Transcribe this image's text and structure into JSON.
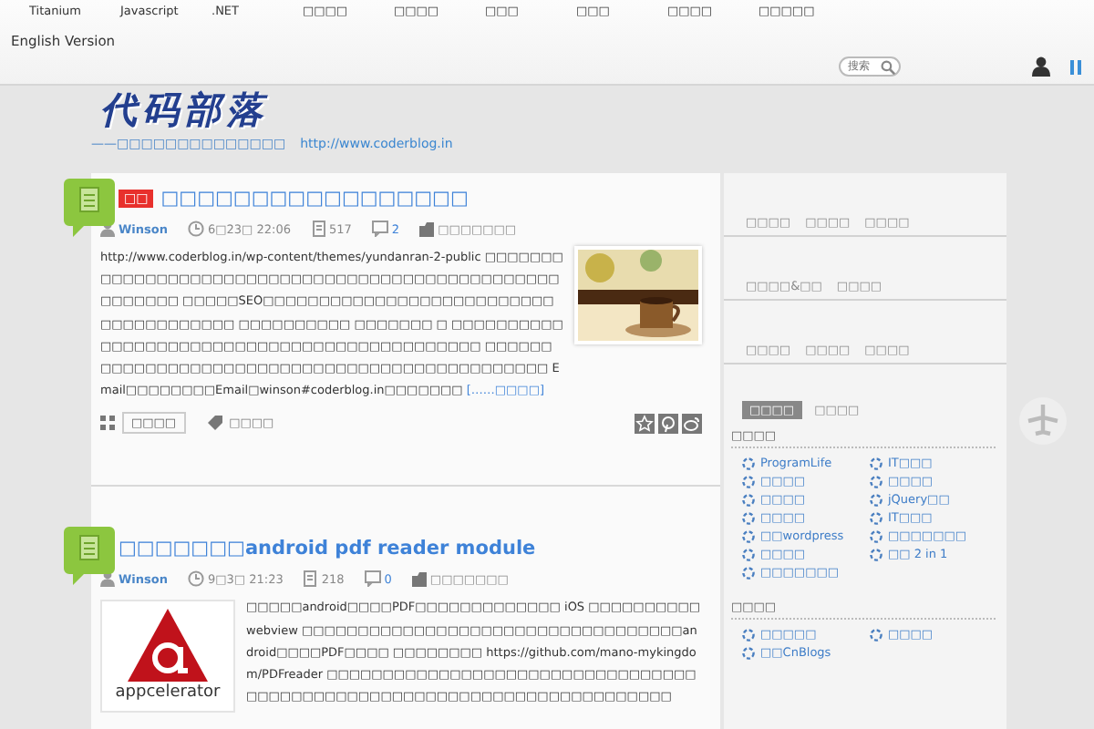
{
  "nav": {
    "items": [
      "Titanium",
      "Javascript",
      ".NET",
      "□□□□",
      "□□□□",
      "□□□",
      "□□□",
      "□□□□",
      "□□□□□"
    ],
    "language_link": "English Version"
  },
  "search": {
    "placeholder": "搜索"
  },
  "logo": {
    "title": "代码部落",
    "tagline": "——□□□□□□□□□□□□□□",
    "url": "http://www.coderblog.in"
  },
  "posts": [
    {
      "badge": "□□",
      "title": "□□□□□□□□□□□□□□□□□",
      "author": "Winson",
      "date": "6□23□ 22:06",
      "views": "517",
      "comments": "2",
      "category": "□□□□□□□",
      "body": "http://www.coderblog.in/wp-content/themes/yundanran-2-public □□□□□□□ □□□□□□□□□□□□□□□□□□□□□□□□□□□□□□□□□□□□□□□□□□□□□□□□ □□□□□SEO□□□□□□□□□□□□□□□□□□□□□□□□□□□□□□□□□□□□□□ □□□□□□□□□□ □□□□□□□ □ □□□□□□□□□□□□□□□□□□□□□□□□□□□□□□□□□□□□□□□□□□□□ □□□□□□ □□□□□□□□□□□□□□□□□□□□□□□□□□□□□□□□□□□□□□□□ Email□□□□□□□□Email□winson#coderblog.in□□□□□□□",
      "more": "[……□□□□]",
      "category_tag": "□□□□",
      "tags": "□□□□"
    },
    {
      "title": "□□□□□□□android pdf reader module",
      "author": "Winson",
      "date": "9□3□ 21:23",
      "views": "218",
      "comments": "0",
      "category": "□□□□□□□",
      "body": "□□□□□android□□□□PDF□□□□□□□□□□□□□ iOS □□□□□□□□□□ webview □□□□□□□□□□□□□□□□□□□□□□□□□□□□□□□□□□android□□□□PDF□□□□ □□□□□□□□ https://github.com/mano-mykingdom/PDFreader □□□□□□□□□□□□□□□□□□□□□□□□□□□□□□□□□□□□□□□□□□□□□□□□□□□□□□□□□□□□□□□□□□□□□□□",
      "thumbnail": {
        "kind": "logo",
        "text": "appcelerator"
      }
    }
  ],
  "sidebar": {
    "tab_rows": [
      [
        "□□□□",
        "□□□□",
        "□□□□"
      ],
      [
        "□□□□&□□",
        "□□□□"
      ],
      [
        "□□□□",
        "□□□□",
        "□□□□"
      ]
    ],
    "tabs": [
      {
        "label": "□□□□",
        "selected": true
      },
      {
        "label": "□□□□",
        "selected": false
      }
    ],
    "sections": [
      {
        "heading": "□□□□",
        "links": [
          "ProgramLife",
          "IT□□□",
          "□□□□",
          "□□□□",
          "□□□□",
          "jQuery□□",
          "□□□□",
          "IT□□□",
          "□□wordpress",
          "□□□□□□□",
          "□□□□",
          "□□ 2 in 1",
          "□□□□□□□"
        ]
      },
      {
        "heading": "□□□□",
        "links": [
          "□□□□□",
          "□□□□",
          "□□CnBlogs"
        ]
      }
    ]
  }
}
